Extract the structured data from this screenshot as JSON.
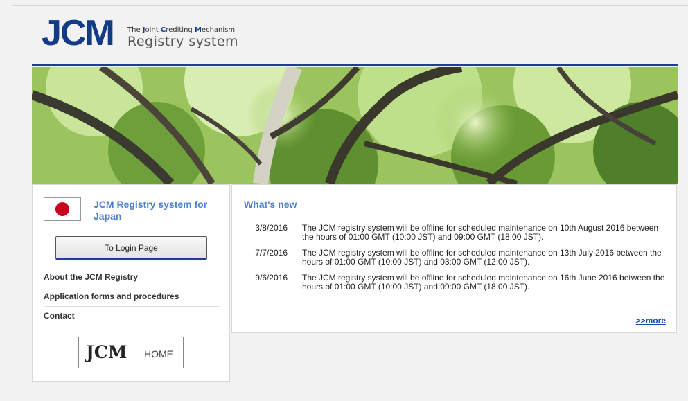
{
  "header": {
    "logo_text": "JCM",
    "subtitle_line1": "The Joint Crediting Mechanism",
    "subtitle_line2": "Registry system"
  },
  "sidebar": {
    "title": "JCM Registry system for Japan",
    "login_button": "To Login Page",
    "menu": [
      {
        "label": "About the JCM Registry"
      },
      {
        "label": "Application forms and procedures"
      },
      {
        "label": "Contact"
      }
    ],
    "home_logo_text": "JCM",
    "home_label": "HOME"
  },
  "news": {
    "title": "What's new",
    "items": [
      {
        "date": "3/8/2016",
        "text": "The JCM registry system will be offline for scheduled maintenance on 10th August 2016 between the hours of 01:00 GMT (10:00 JST) and 09:00 GMT (18:00 JST)."
      },
      {
        "date": "7/7/2016",
        "text": "The JCM registry system will be offline for scheduled maintenance on 13th July 2016 between the hours of 01:00 GMT (10:00 JST) and 03:00 GMT (12:00 JST)."
      },
      {
        "date": "9/6/2016",
        "text": "The JCM registry system will be offline for scheduled maintenance on 16th June 2016 between the hours of 01:00 GMT (10:00 JST) and 09:00 GMT (18:00 JST)."
      }
    ],
    "more_link": ">>more"
  },
  "colors": {
    "brand_blue": "#143b86",
    "link_blue": "#4a7fd1",
    "flag_red": "#c8001e"
  }
}
